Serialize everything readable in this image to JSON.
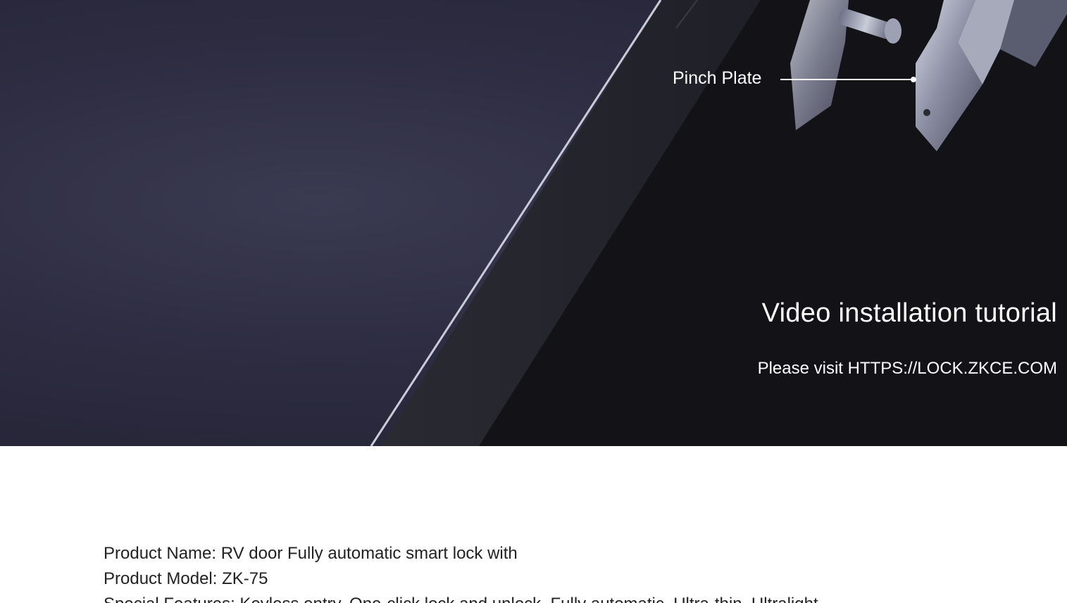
{
  "hero": {
    "callout_label": "Pinch Plate",
    "video_title": "Video installation tutorial",
    "video_link_text": "Please visit HTTPS://LOCK.ZKCE.COM"
  },
  "product_info": {
    "name_line": "Product Name: RV door Fully automatic smart lock with",
    "model_line": "Product Model: ZK-75",
    "features_line": "Special Features: Keyless entry, One-click lock and unlock, Fully automatic, Ultra-thin, Ultralight"
  }
}
